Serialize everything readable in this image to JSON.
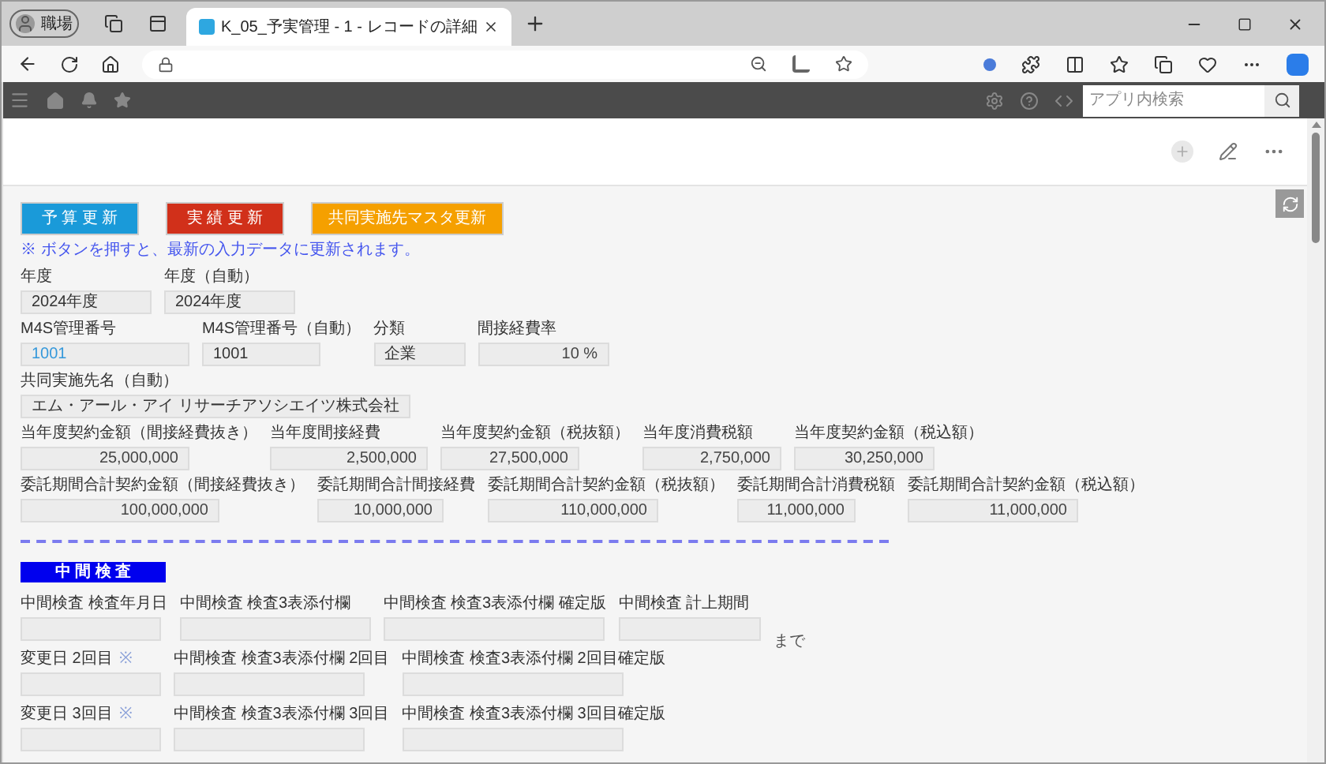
{
  "browser": {
    "profile": "職場",
    "tab_title": "K_05_予実管理 - 1 - レコードの詳細"
  },
  "app_header": {
    "search_placeholder": "アプリ内検索"
  },
  "buttons": [
    {
      "label": "予 算 更 新",
      "color": "#1a9ad9"
    },
    {
      "label": "実 績 更 新",
      "color": "#d1301a"
    },
    {
      "label": "共同実施先マスタ更新",
      "color": "#f5a000"
    }
  ],
  "note": "※ ボタンを押すと、最新の入力データに更新されます。",
  "rows": [
    {
      "fields": [
        {
          "label": "年度",
          "value": "2024年度",
          "kind": "text"
        },
        {
          "label": "年度（自動）",
          "value": "2024年度",
          "kind": "text"
        }
      ]
    },
    {
      "fields": [
        {
          "label": "M4S管理番号",
          "value": "1001",
          "kind": "link"
        },
        {
          "label": "M4S管理番号（自動）",
          "value": "1001",
          "kind": "text"
        },
        {
          "label": "分類",
          "value": "企業",
          "kind": "text"
        },
        {
          "label": "間接経費率",
          "value": "10 %",
          "kind": "number"
        }
      ]
    },
    {
      "fields": [
        {
          "label": "共同実施先名（自動）",
          "value": "エム・アール・アイ リサーチアソシエイツ株式会社",
          "kind": "text"
        }
      ]
    },
    {
      "fields": [
        {
          "label": "当年度契約金額（間接経費抜き）",
          "value": "25,000,000",
          "kind": "number"
        },
        {
          "label": "当年度間接経費",
          "value": "2,500,000",
          "kind": "number"
        },
        {
          "label": "当年度契約金額（税抜額）",
          "value": "27,500,000",
          "kind": "number"
        },
        {
          "label": "当年度消費税額",
          "value": "2,750,000",
          "kind": "number"
        },
        {
          "label": "当年度契約金額（税込額）",
          "value": "30,250,000",
          "kind": "number"
        }
      ]
    },
    {
      "fields": [
        {
          "label": "委託期間合計契約金額（間接経費抜き）",
          "value": "100,000,000",
          "kind": "number"
        },
        {
          "label": "委託期間合計間接経費",
          "value": "10,000,000",
          "kind": "number"
        },
        {
          "label": "委託期間合計契約金額（税抜額）",
          "value": "110,000,000",
          "kind": "number"
        },
        {
          "label": "委託期間合計消費税額",
          "value": "11,000,000",
          "kind": "number"
        },
        {
          "label": "委託期間合計契約金額（税込額）",
          "value": "11,000,000",
          "kind": "number"
        }
      ]
    }
  ],
  "section": {
    "title": "中 間 検 査",
    "rows": [
      {
        "fields": [
          {
            "label": "中間検査 検査年月日"
          },
          {
            "label": "中間検査 検査3表添付欄"
          },
          {
            "label": "中間検査 検査3表添付欄 確定版"
          },
          {
            "label": "中間検査 計上期間",
            "suffix": "まで"
          }
        ]
      },
      {
        "fields": [
          {
            "label": "変更日 2回目",
            "mark": "※"
          },
          {
            "label": "中間検査 検査3表添付欄 2回目"
          },
          {
            "label": "中間検査 検査3表添付欄 2回目確定版"
          }
        ]
      },
      {
        "fields": [
          {
            "label": "変更日 3回目",
            "mark": "※"
          },
          {
            "label": "中間検査 検査3表添付欄 3回目"
          },
          {
            "label": "中間検査 検査3表添付欄 3回目確定版"
          }
        ]
      }
    ]
  }
}
